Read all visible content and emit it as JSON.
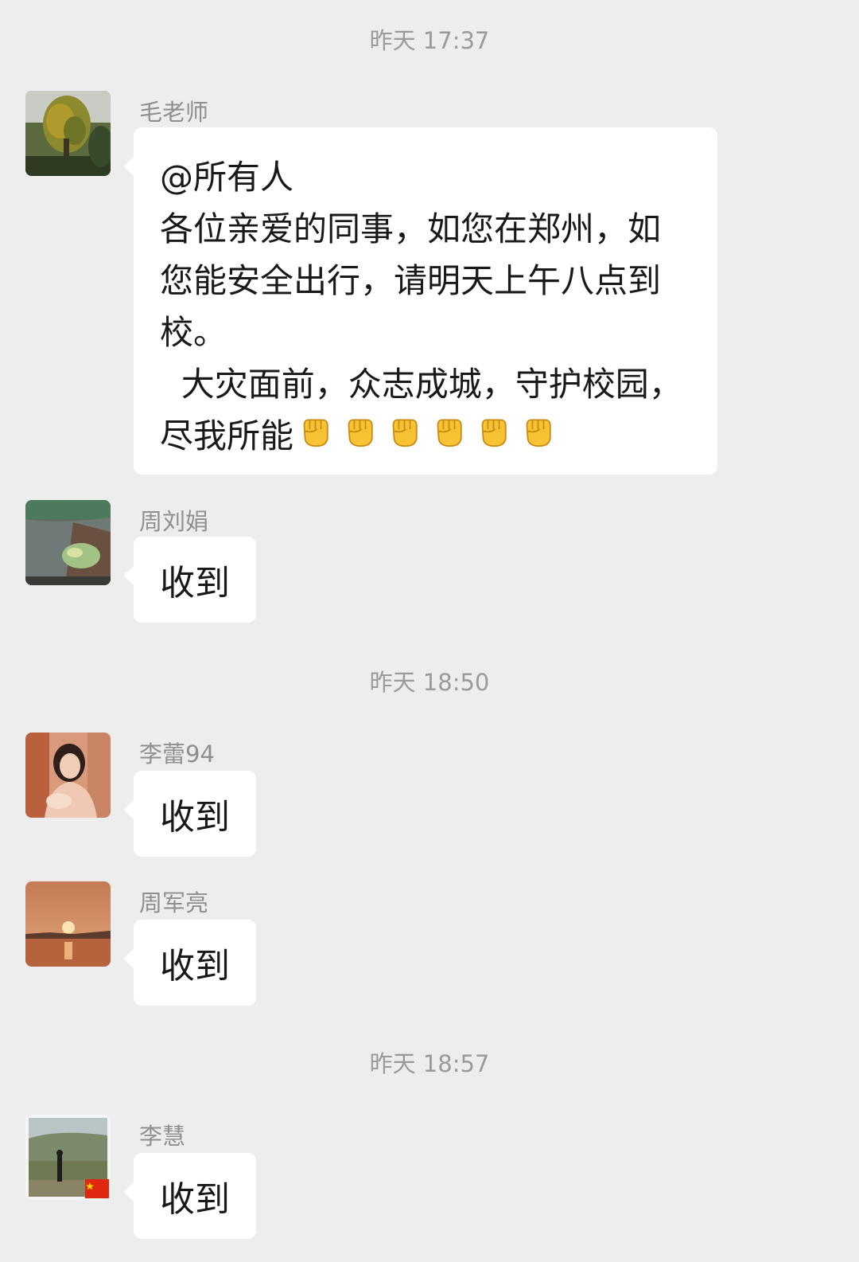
{
  "timestamps": [
    "昨天 17:37",
    "昨天 18:50",
    "昨天 18:57"
  ],
  "messages": [
    {
      "sender": "毛老师",
      "lines": [
        "@所有人",
        "各位亲爱的同事，如您在郑州，如",
        "您能安全出行，请明天上午八点到",
        "校。",
        "  大灾面前，众志成城，守护校园，",
        "尽我所能"
      ],
      "emojis": [
        "✊",
        "✊",
        "✊",
        "✊",
        "✊",
        "✊"
      ]
    },
    {
      "sender": "周刘娟",
      "text": "收到"
    },
    {
      "sender": "李蕾94",
      "text": "收到"
    },
    {
      "sender": "周军亮",
      "text": "收到"
    },
    {
      "sender": "李慧",
      "text": "收到"
    }
  ],
  "icons": {
    "avatar_mao": "tree-landscape-avatar",
    "avatar_zhouliujuan": "pond-leaf-avatar",
    "avatar_lilei": "woman-portrait-avatar",
    "avatar_zhoujunliang": "sunset-lake-avatar",
    "avatar_lihui": "hillside-person-avatar",
    "flag": "china-flag-badge",
    "emoji": "raised-fist-emoji"
  },
  "colors": {
    "background": "#ededed",
    "bubble": "#ffffff",
    "text": "#191919",
    "meta": "#9a9a9a",
    "emoji": "#f7c233"
  }
}
